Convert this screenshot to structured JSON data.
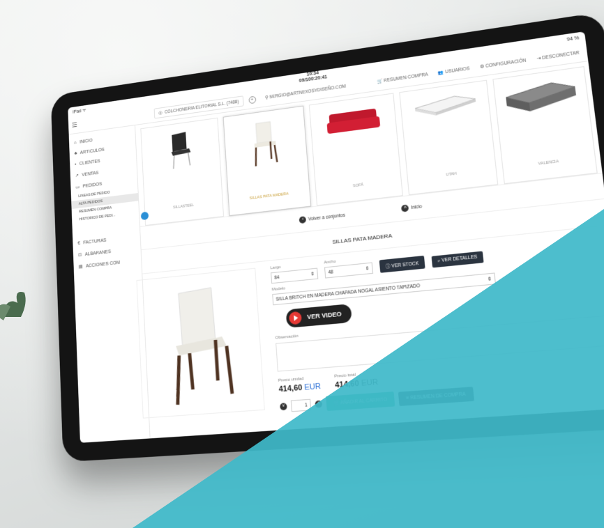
{
  "status": {
    "left": "iPad ᯤ",
    "time": "10:34",
    "date": "09/100:20:41",
    "battery": "94 %"
  },
  "header": {
    "menu_icon": "hamburger-icon",
    "client": "COLCHONERIA ELITORIAL S.L. (7488)",
    "user": "SERGIO@ARTNEXOSYDISEÑO.COM",
    "nav": [
      "RESUMEN COMPRA",
      "USUARIOS",
      "CONFIGURACIÓN",
      "DESCONECTAR"
    ]
  },
  "sidebar": {
    "items": [
      "INICIO",
      "ARTICULOS",
      "CLIENTES",
      "VENTAS",
      "PEDIDOS"
    ],
    "sub_items": [
      "LINEAS DE PEDIDO",
      "ALTA PEDIDOS",
      "RESUMEN COMPRA",
      "HISTORICO DE PEDI..."
    ],
    "items_bottom": [
      "FACTURAS",
      "ALBARANES",
      "ACCIONES COM"
    ]
  },
  "products": [
    {
      "label": "SILLASTEEL"
    },
    {
      "label": "SILLAS PATA MADERA"
    },
    {
      "label": "SOFÁ"
    },
    {
      "label": "UTAH"
    },
    {
      "label": "VALENCIA"
    }
  ],
  "nav": {
    "back": "Volver a conjuntos",
    "home": "Inicio"
  },
  "section_title": "SILLAS PATA MADERA",
  "form": {
    "largo_label": "Largo",
    "largo_value": "84",
    "ancho_label": "Ancho",
    "ancho_value": "48",
    "ver_stock": "VER STOCK",
    "ver_detalles": "VER DETALLES",
    "modelo_label": "Modelo",
    "modelo_value": "SILLA BRITCH EN MADERA CHAPADA NOGAL ASIENTO TAPIZADO",
    "video_label": "VER VIDEO",
    "observacion_label": "Observación",
    "precio_unidad_label": "Precio unidad",
    "precio_unidad_value": "414,60",
    "precio_total_label": "Precio total",
    "precio_total_value": "414,60",
    "currency": "EUR",
    "quantity": "1",
    "add_to_cart": "AÑADIR AL CARRITO",
    "summary": "RESUMEN DE COMPRA"
  },
  "colors": {
    "teal": "#3fb9c9",
    "dark": "#2b3440",
    "green": "#2fb08a",
    "gold": "#c9a03a"
  }
}
